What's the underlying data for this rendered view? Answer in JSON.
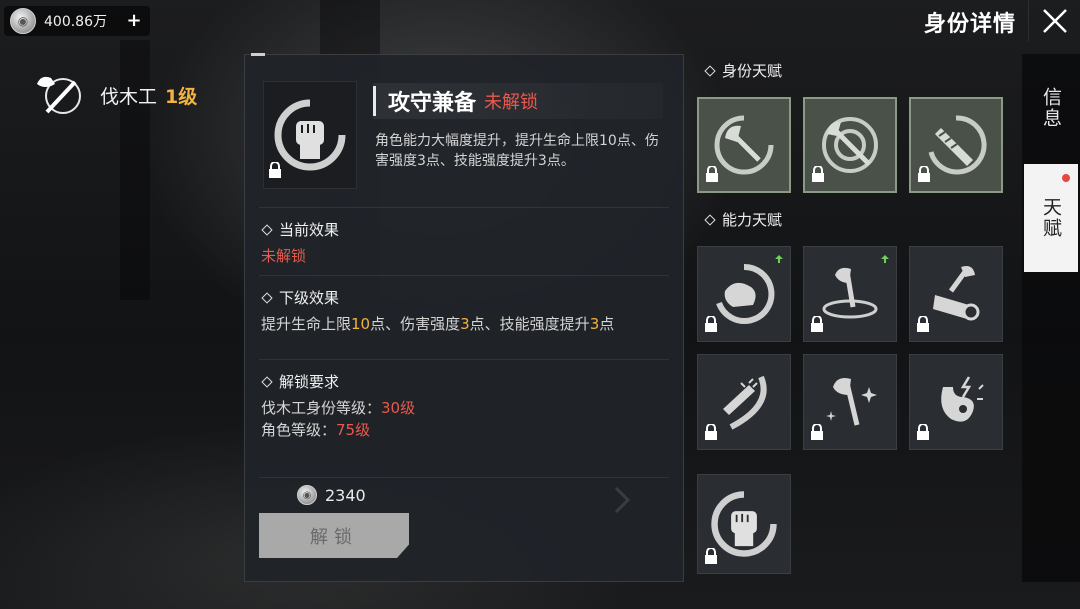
{
  "topbar": {
    "currency_value": "400.86万",
    "plus_label": "+",
    "page_title": "身份详情"
  },
  "identity": {
    "name": "伐木工",
    "level": "1级"
  },
  "detail": {
    "talent_name": "攻守兼备",
    "status": "未解锁",
    "description": "角色能力大幅度提升，提升生命上限10点、伤害强度3点、技能强度提升3点。",
    "current_effect": {
      "title": "当前效果",
      "value": "未解锁"
    },
    "next_effect": {
      "title": "下级效果",
      "parts": [
        "提升生命上限",
        "10",
        "点、伤害强度",
        "3",
        "点、技能强度提升",
        "3",
        "点"
      ]
    },
    "unlock_req": {
      "title": "解锁要求",
      "line1_label": "伐木工身份等级：",
      "line1_value": "30级",
      "line2_label": "角色等级：",
      "line2_value": "75级"
    },
    "cost": "2340",
    "unlock_button": "解锁"
  },
  "groups": {
    "identity_talents_title": "身份天赋",
    "ability_talents_title": "能力天赋"
  },
  "identity_talents": [
    {
      "icon": "axe-icon"
    },
    {
      "icon": "axe-target-icon"
    },
    {
      "icon": "saw-icon"
    }
  ],
  "ability_talents": [
    {
      "icon": "flexed-arm-icon",
      "upgradable": true
    },
    {
      "icon": "axe-stump-icon",
      "upgradable": true
    },
    {
      "icon": "axe-log-icon",
      "upgradable": false
    },
    {
      "icon": "chainsaw-slash-icon",
      "upgradable": false
    },
    {
      "icon": "sparkle-axe-icon",
      "upgradable": false
    },
    {
      "icon": "lightning-stomach-icon",
      "upgradable": false
    },
    {
      "icon": "fist-icon",
      "upgradable": false
    }
  ],
  "side_tabs": [
    {
      "label": "信息"
    },
    {
      "label": "天赋"
    }
  ],
  "colors": {
    "accent_red": "#e85a4e",
    "accent_gold": "#f3b33e"
  }
}
